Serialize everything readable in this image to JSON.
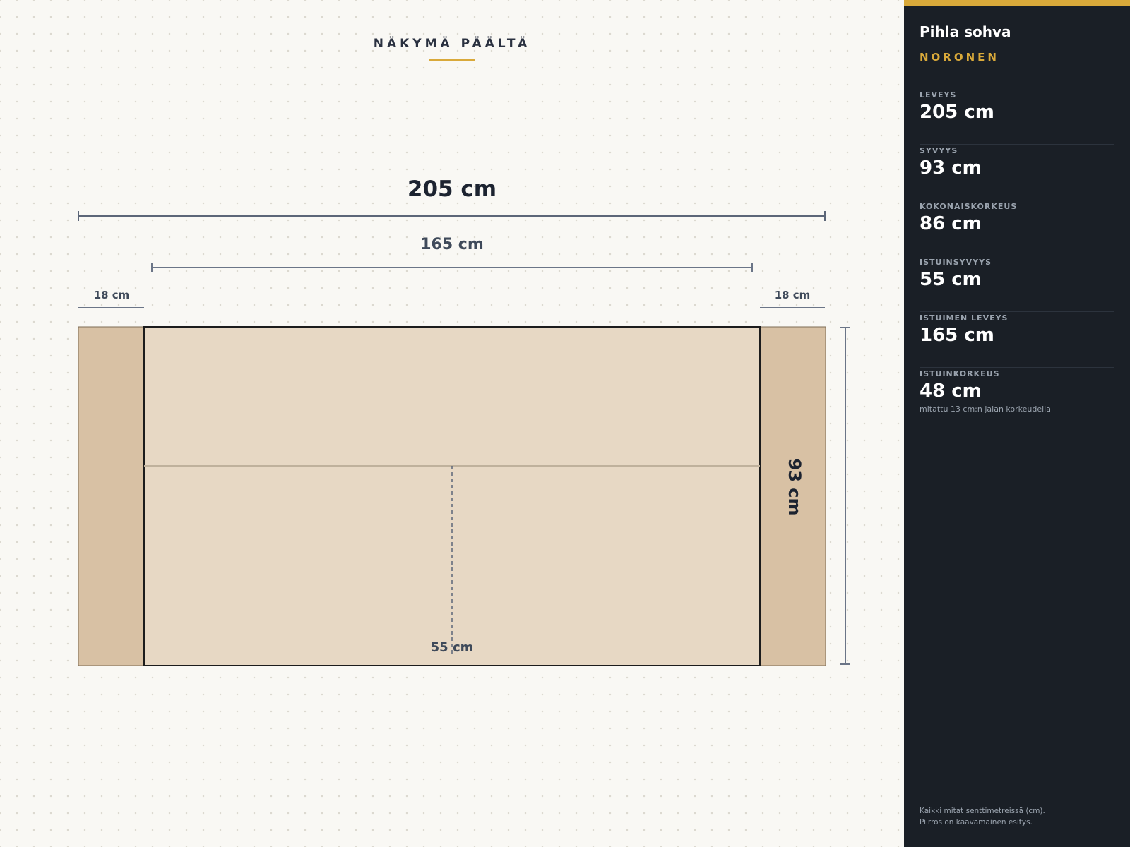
{
  "view_title": "NÄKYMÄ PÄÄLTÄ",
  "diagram": {
    "total_width": "205 cm",
    "seat_width": "165 cm",
    "left_arm_width": "18 cm",
    "right_arm_width": "18 cm",
    "seat_depth": "55 cm",
    "total_depth": "93 cm"
  },
  "sidebar": {
    "product_name": "Pihla sohva",
    "brand": "NORONEN",
    "specs": [
      {
        "label": "LEVEYS",
        "value": "205 cm"
      },
      {
        "label": "SYVYYS",
        "value": "93 cm"
      },
      {
        "label": "KOKONAISKORKEUS",
        "value": "86 cm"
      },
      {
        "label": "ISTUINSYVYYS",
        "value": "55 cm"
      },
      {
        "label": "ISTUIMEN LEVEYS",
        "value": "165 cm"
      },
      {
        "label": "ISTUINKORKEUS",
        "value": "48 cm"
      }
    ],
    "seat_height_note": "mitattu 13 cm:n jalan korkeudella",
    "footer_line1": "Kaikki mitat senttimetreissä (cm).",
    "footer_line2": "Piirros on kaavamainen esitys."
  },
  "colors": {
    "accent": "#d9a93a",
    "sidebar_bg": "#1a1f26",
    "armrest": "#d8c1a4",
    "seat": "#e7d8c4"
  }
}
